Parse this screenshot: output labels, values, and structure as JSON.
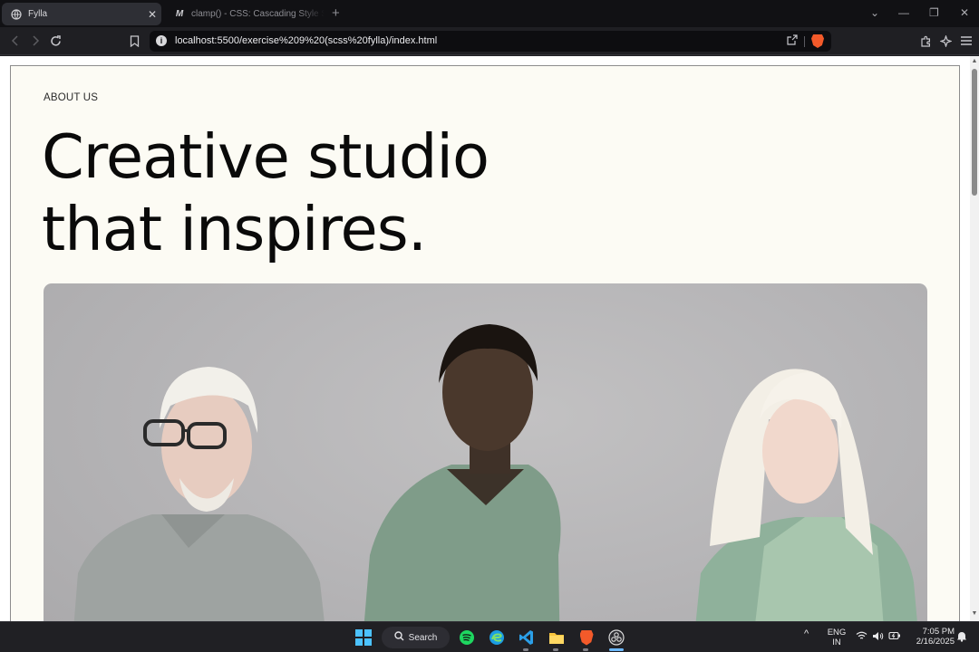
{
  "browser": {
    "tabs": [
      {
        "title": "Fylla",
        "active": true
      },
      {
        "title": "clamp() - CSS: Cascading Style Sheets",
        "active": false
      }
    ],
    "url": "localhost:5500/exercise%209%20(scss%20fylla)/index.html",
    "icons": {
      "back": "arrow-left-icon",
      "forward": "arrow-right-icon",
      "reload": "reload-icon",
      "bookmark": "bookmark-icon",
      "site_info": "info-icon",
      "share": "share-icon",
      "brave_shields": "brave-lion-icon",
      "extensions": "puzzle-icon",
      "leo": "sparkle-icon",
      "menu": "hamburger-menu-icon"
    }
  },
  "page": {
    "eyebrow": "ABOUT US",
    "headline_line1": "Creative studio",
    "headline_line2": "that inspires.",
    "hero_image": "three-people-portrait-photo"
  },
  "taskbar": {
    "search_label": "Search",
    "apps": [
      "start-icon",
      "search-icon",
      "spotify-icon",
      "edge-icon",
      "vscode-icon",
      "file-explorer-icon",
      "brave-icon",
      "obs-icon"
    ],
    "language_line1": "ENG",
    "language_line2": "IN",
    "time": "7:05 PM",
    "date": "2/16/2025"
  },
  "colors": {
    "page_background": "#fcfbf4",
    "headline": "#0a0a0a",
    "browser_chrome": "#1f1f23",
    "accent": "#4cc2ff"
  }
}
